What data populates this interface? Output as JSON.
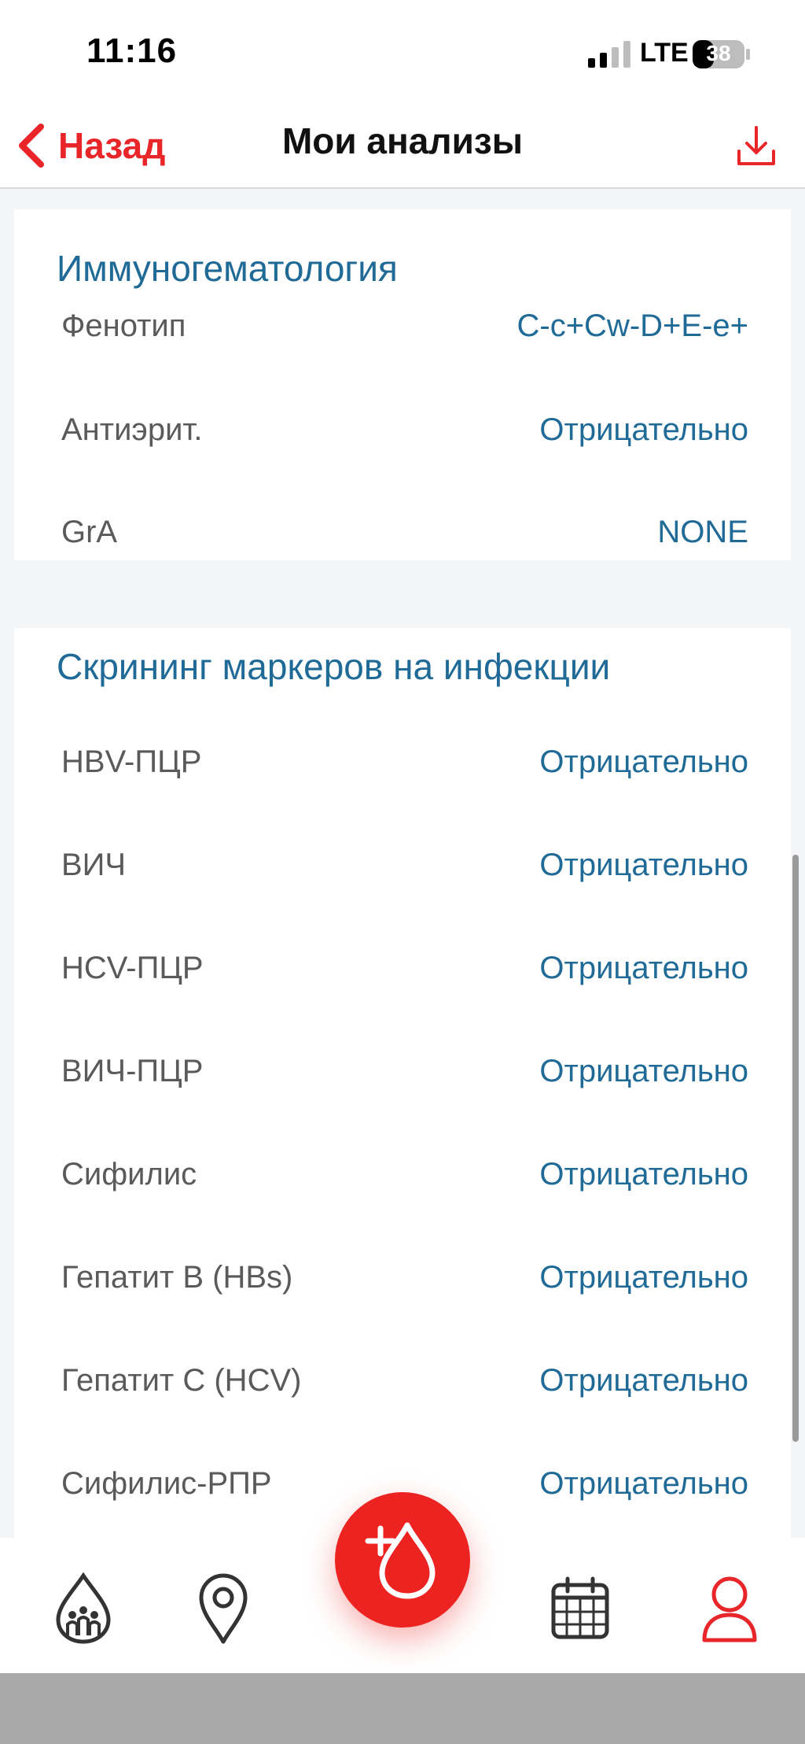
{
  "status_bar": {
    "time": "11:16",
    "network": "LTE",
    "battery": "38"
  },
  "nav": {
    "back_label": "Назад",
    "title": "Мои анализы"
  },
  "sections": {
    "immuno": {
      "title": "Иммуногематология",
      "rows": [
        {
          "label": "Фенотип",
          "value": "C-c+Cw-D+E-e+"
        },
        {
          "label": "Антиэрит.",
          "value": "Отрицательно"
        },
        {
          "label": "GrA",
          "value": "NONE"
        }
      ]
    },
    "screening": {
      "title": "Скрининг маркеров на инфекции",
      "rows": [
        {
          "label": "HBV-ПЦР",
          "value": "Отрицательно"
        },
        {
          "label": "ВИЧ",
          "value": "Отрицательно"
        },
        {
          "label": "HCV-ПЦР",
          "value": "Отрицательно"
        },
        {
          "label": "ВИЧ-ПЦР",
          "value": "Отрицательно"
        },
        {
          "label": "Сифилис",
          "value": "Отрицательно"
        },
        {
          "label": "Гепатит B (HBs)",
          "value": "Отрицательно"
        },
        {
          "label": "Гепатит C (HCV)",
          "value": "Отрицательно"
        },
        {
          "label": "Сифилис-РПР",
          "value": "Отрицательно"
        }
      ]
    }
  },
  "tabs": [
    {
      "icon": "blood-drop-people-icon"
    },
    {
      "icon": "map-pin-icon"
    },
    {
      "icon": "add-donation-icon"
    },
    {
      "icon": "calendar-icon"
    },
    {
      "icon": "profile-icon"
    }
  ],
  "colors": {
    "accent_red": "#e8262a",
    "value_blue": "#1f6a96",
    "label_gray": "#5a5a5a",
    "background": "#f4f5f7"
  }
}
